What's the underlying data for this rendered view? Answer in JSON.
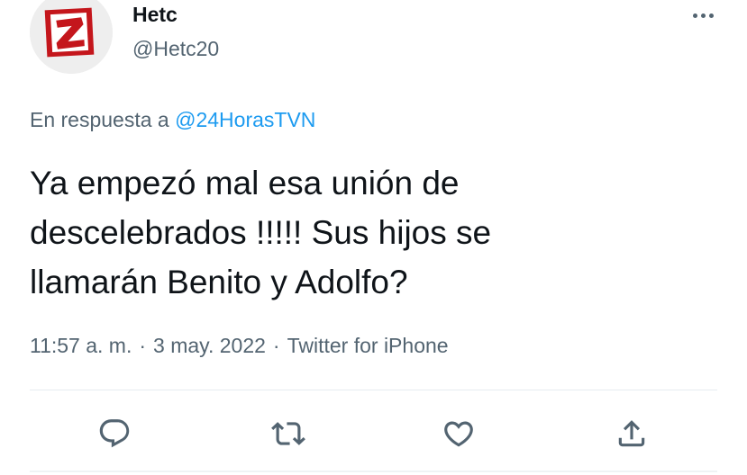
{
  "author": {
    "display_name": "Hetc",
    "handle": "@Hetc20",
    "avatar_letter": "Z"
  },
  "reply": {
    "prefix": "En respuesta a",
    "mention": "@24HorasTVN"
  },
  "tweet": {
    "text": "Ya empezó mal esa unión de\ndescelebrados !!!!! Sus hijos se\nllamarán Benito y Adolfo?"
  },
  "meta": {
    "time": "11:57 a. m.",
    "date": "3 may. 2022",
    "source": "Twitter for iPhone",
    "separator": "·"
  },
  "actions": {
    "reply_icon": "reply-icon",
    "retweet_icon": "retweet-icon",
    "like_icon": "like-icon",
    "share_icon": "share-icon"
  },
  "colors": {
    "text": "#0f1419",
    "secondary": "#536471",
    "link": "#1d9bf0",
    "avatar_red": "#c4161c"
  }
}
